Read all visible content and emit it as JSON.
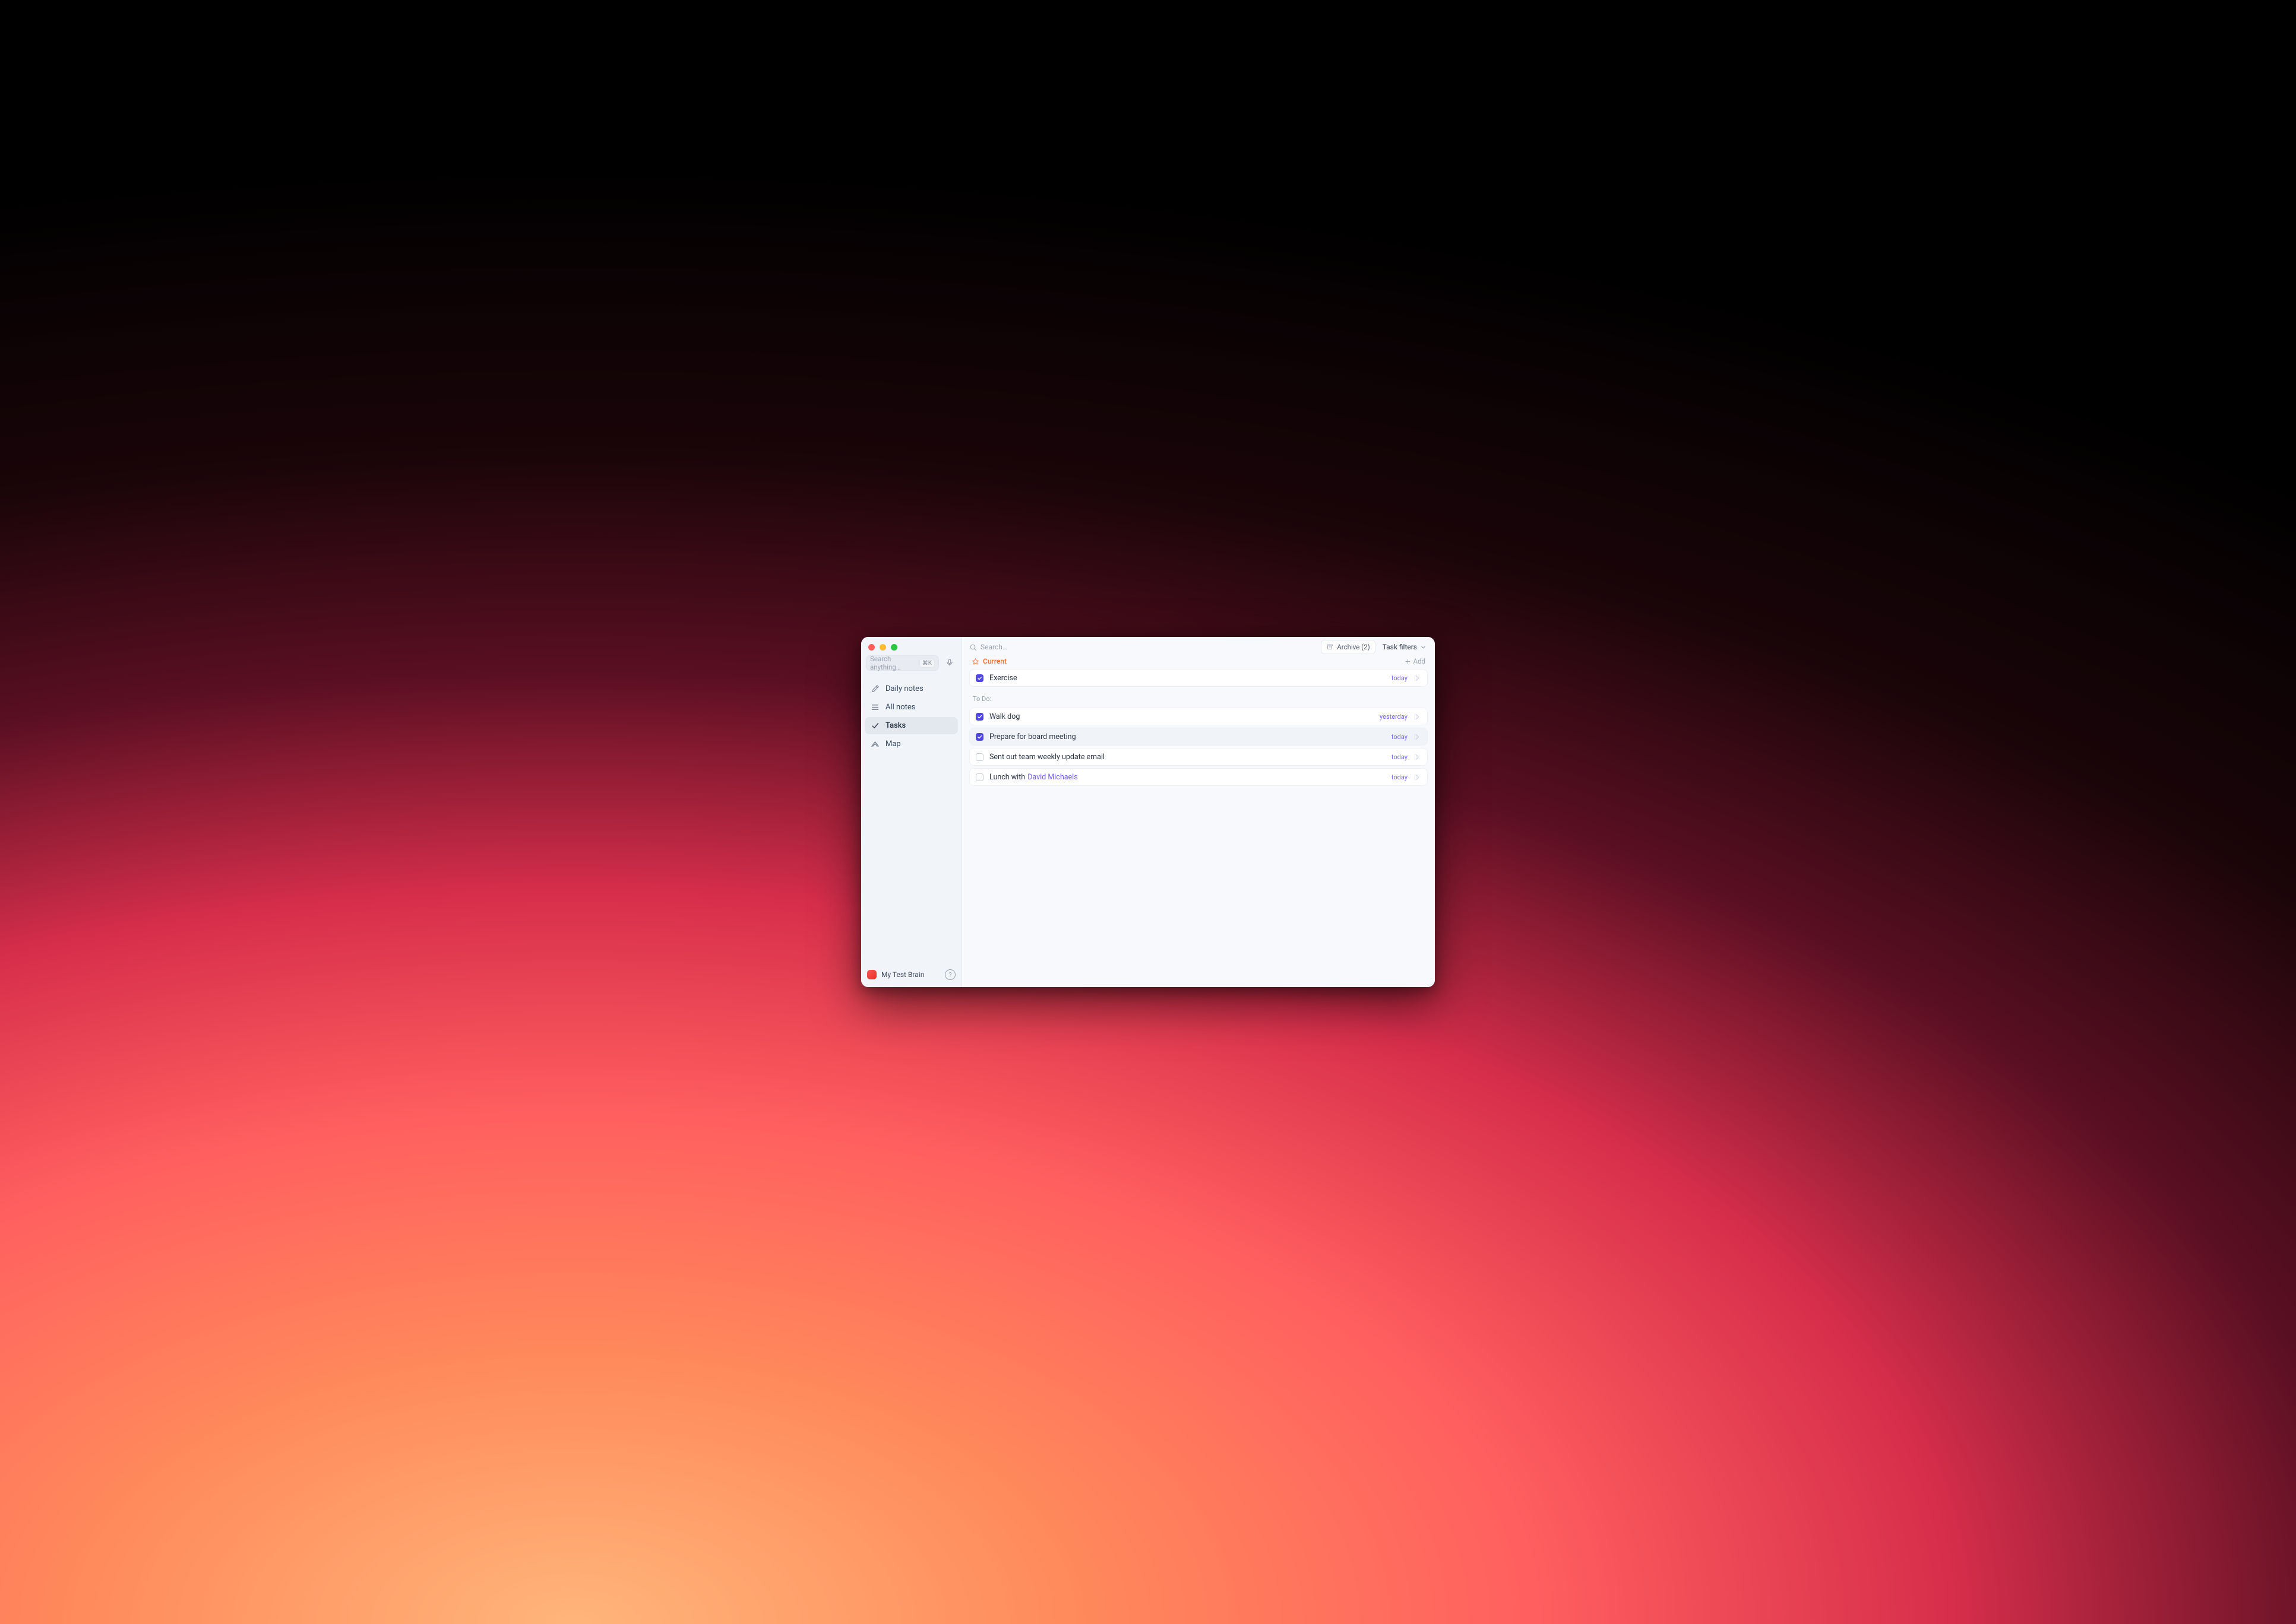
{
  "sidebar": {
    "search_placeholder": "Search anything…",
    "shortcut": "⌘K",
    "nav": [
      {
        "label": "Daily notes",
        "icon": "edit"
      },
      {
        "label": "All notes",
        "icon": "list"
      },
      {
        "label": "Tasks",
        "icon": "check",
        "active": true
      },
      {
        "label": "Map",
        "icon": "map"
      }
    ],
    "workspace": "My Test Brain"
  },
  "topbar": {
    "search_placeholder": "Search…",
    "archive_label": "Archive (2)",
    "filters_label": "Task filters"
  },
  "section": {
    "title": "Current",
    "add_label": "Add"
  },
  "tasks_current": [
    {
      "title": "Exercise",
      "checked": true,
      "due": "today"
    }
  ],
  "subheading": "To Do:",
  "tasks_todo": [
    {
      "title": "Walk dog",
      "checked": true,
      "due": "yesterday"
    },
    {
      "title": "Prepare for board meeting",
      "checked": true,
      "due": "today",
      "selected": true
    },
    {
      "title": "Sent out team weekly update email",
      "checked": false,
      "due": "today"
    },
    {
      "title": "Lunch with ",
      "mention": "David Michaels",
      "checked": false,
      "due": "today"
    }
  ]
}
